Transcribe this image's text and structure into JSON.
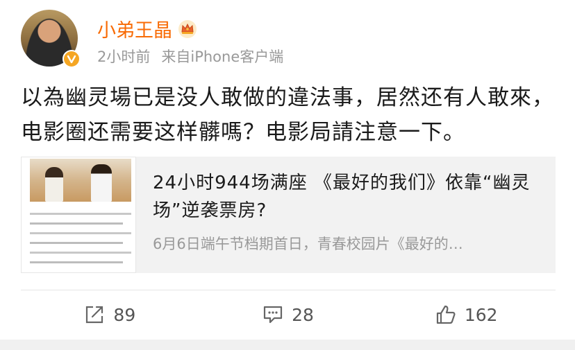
{
  "author": {
    "name": "小弟王晶",
    "avatar_icon": "avatar-photo",
    "badge_icon": "crown-icon",
    "verified_icon": "verified-v-icon",
    "name_color": "#f86b05"
  },
  "meta": {
    "time": "2小时前",
    "source": "来自iPhone客户端"
  },
  "content": {
    "text": "以為幽灵場已是没人敢做的違法事，居然还有人敢來，电影圈还需要这样髒嗎？电影局請注意一下。"
  },
  "card": {
    "title": "24小时944场满座 《最好的我们》依靠“幽灵场”逆袭票房?",
    "description": "6月6日端午节档期首日，青春校园片《最好的…"
  },
  "actions": {
    "repost_count": "89",
    "comment_count": "28",
    "like_count": "162"
  }
}
